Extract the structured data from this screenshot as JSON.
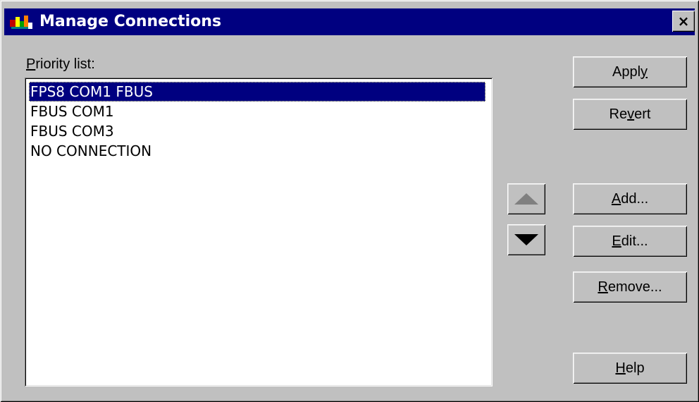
{
  "window": {
    "title": "Manage Connections",
    "close_label": "×",
    "colors": {
      "titlebar": "#000080",
      "face": "#c0c0c0",
      "selection": "#000080"
    }
  },
  "priority_list": {
    "label_mnemonic": "P",
    "label_rest": "riority list:",
    "items": [
      "FPS8 COM1 FBUS",
      "FBUS COM1",
      "FBUS COM3",
      "NO CONNECTION"
    ],
    "selected_index": 0
  },
  "buttons": {
    "apply": {
      "pre": "Appl",
      "mn": "y",
      "post": ""
    },
    "revert": {
      "pre": "Re",
      "mn": "v",
      "post": "ert"
    },
    "add": {
      "pre": "",
      "mn": "A",
      "post": "dd..."
    },
    "edit": {
      "pre": "",
      "mn": "E",
      "post": "dit..."
    },
    "remove": {
      "pre": "",
      "mn": "R",
      "post": "emove..."
    },
    "help": {
      "pre": "",
      "mn": "H",
      "post": "elp"
    }
  },
  "icons": {
    "title": "manage-connections-app-icon",
    "move_up": "triangle-up-icon",
    "move_down": "triangle-down-icon"
  }
}
